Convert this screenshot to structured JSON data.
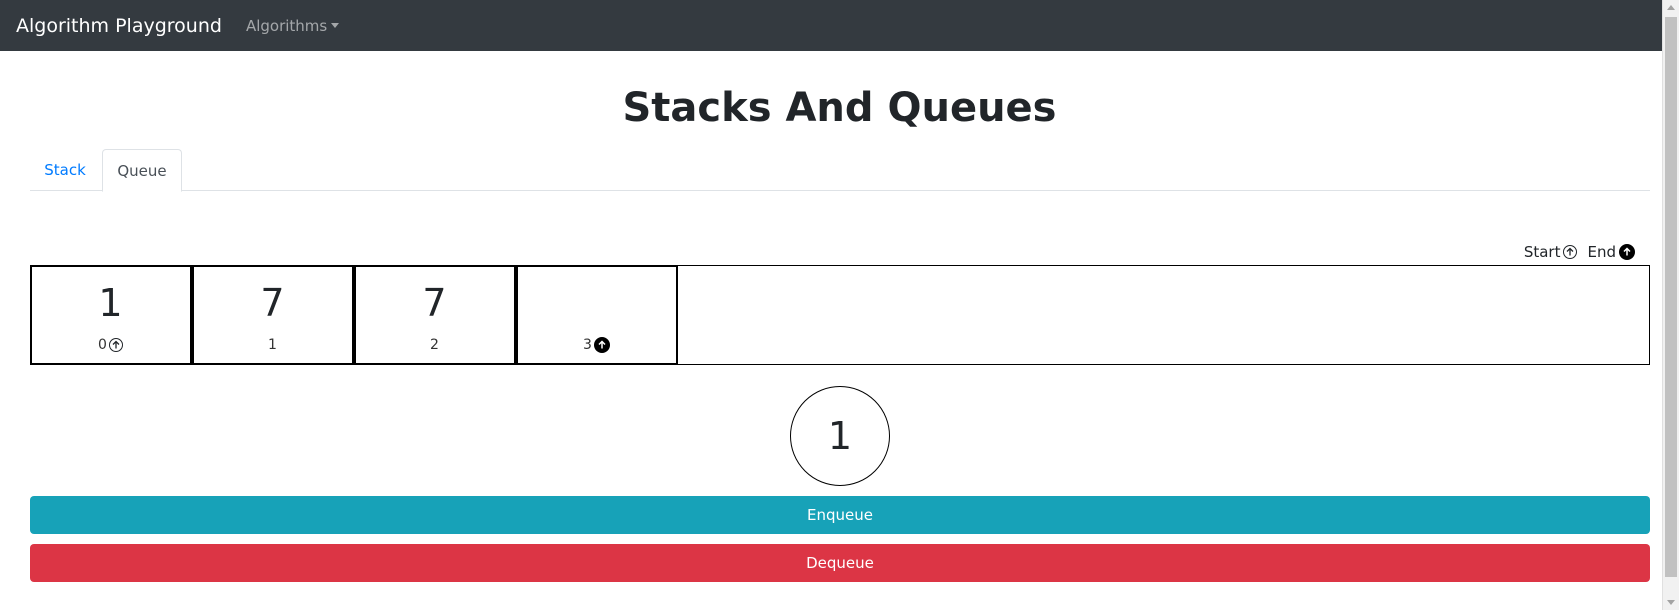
{
  "navbar": {
    "brand": "Algorithm Playground",
    "dropdown_label": "Algorithms"
  },
  "page": {
    "title": "Stacks And Queues"
  },
  "tabs": [
    {
      "label": "Stack",
      "active": false
    },
    {
      "label": "Queue",
      "active": true
    }
  ],
  "legend": {
    "start_label": "Start",
    "end_label": "End"
  },
  "queue": {
    "cells": [
      {
        "value": "1",
        "index": "0",
        "marker": "start"
      },
      {
        "value": "7",
        "index": "1",
        "marker": ""
      },
      {
        "value": "7",
        "index": "2",
        "marker": ""
      },
      {
        "value": "",
        "index": "3",
        "marker": "end"
      }
    ]
  },
  "current_value": "1",
  "buttons": {
    "enqueue_label": "Enqueue",
    "dequeue_label": "Dequeue"
  },
  "colors": {
    "navbar": "#343a40",
    "enqueue": "#17a2b8",
    "dequeue": "#dc3545",
    "tab_link": "#007bff"
  }
}
